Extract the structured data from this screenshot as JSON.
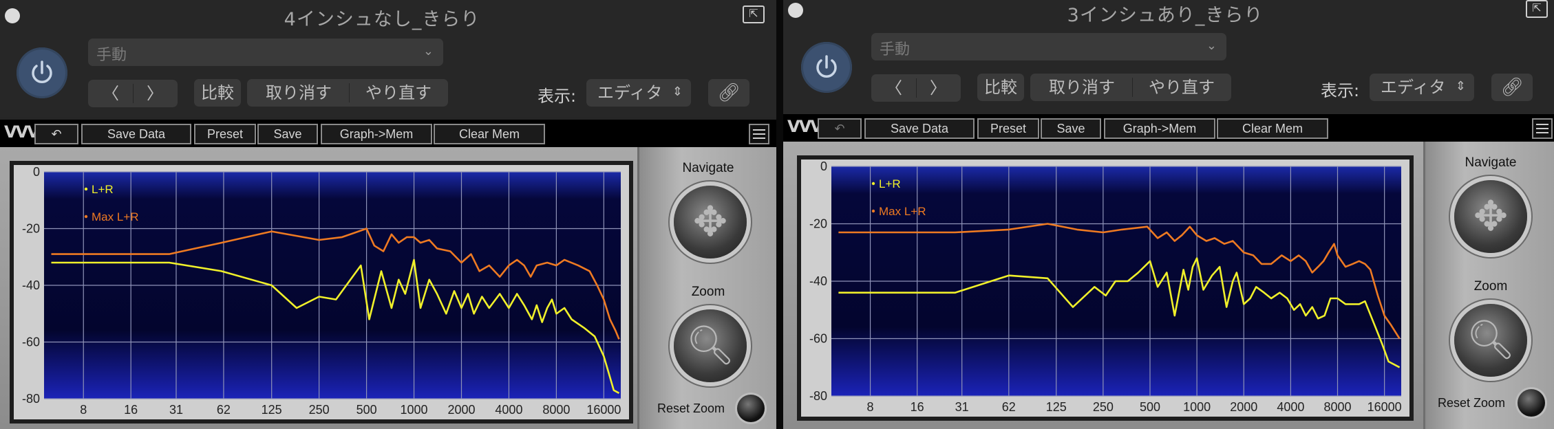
{
  "windows": [
    {
      "title": "4インシュなし_きらり",
      "preset_placeholder": "手動",
      "compare": "比較",
      "undo": "取り消す",
      "redo": "やり直す",
      "display_label": "表示:",
      "display_value": "エディタ",
      "toolbar": {
        "save_data": "Save Data",
        "preset": "Preset",
        "save": "Save",
        "graph_mem": "Graph->Mem",
        "clear_mem": "Clear Mem"
      },
      "navigate": "Navigate",
      "zoom": "Zoom",
      "reset_zoom": "Reset Zoom",
      "chart_data": {
        "type": "line",
        "x_ticks": [
          "8",
          "16",
          "31",
          "62",
          "125",
          "250",
          "500",
          "1000",
          "2000",
          "4000",
          "8000",
          "16000"
        ],
        "y_ticks": [
          "0",
          "-20",
          "-40",
          "-60",
          "-80"
        ],
        "ylim": [
          -80,
          0
        ],
        "series": [
          {
            "name": "L+R",
            "color": "#f0f02a",
            "points": [
              [
                5,
                -32
              ],
              [
                28,
                -32
              ],
              [
                60,
                -35
              ],
              [
                125,
                -40
              ],
              [
                180,
                -48
              ],
              [
                250,
                -44
              ],
              [
                320,
                -45
              ],
              [
                460,
                -33
              ],
              [
                520,
                -52
              ],
              [
                620,
                -35
              ],
              [
                720,
                -48
              ],
              [
                800,
                -38
              ],
              [
                880,
                -43
              ],
              [
                1000,
                -31
              ],
              [
                1100,
                -48
              ],
              [
                1250,
                -38
              ],
              [
                1400,
                -43
              ],
              [
                1600,
                -50
              ],
              [
                1800,
                -42
              ],
              [
                2000,
                -48
              ],
              [
                2200,
                -43
              ],
              [
                2400,
                -50
              ],
              [
                2700,
                -44
              ],
              [
                3000,
                -48
              ],
              [
                3500,
                -43
              ],
              [
                4000,
                -48
              ],
              [
                4500,
                -43
              ],
              [
                5000,
                -47
              ],
              [
                5600,
                -52
              ],
              [
                6000,
                -47
              ],
              [
                6500,
                -53
              ],
              [
                7000,
                -48
              ],
              [
                7500,
                -45
              ],
              [
                8000,
                -50
              ],
              [
                9000,
                -48
              ],
              [
                10000,
                -52
              ],
              [
                12000,
                -55
              ],
              [
                14000,
                -58
              ],
              [
                16000,
                -65
              ],
              [
                17000,
                -70
              ],
              [
                18500,
                -77
              ],
              [
                20000,
                -78
              ]
            ]
          },
          {
            "name": "Max L+R",
            "color": "#ee7a22",
            "points": [
              [
                5,
                -29
              ],
              [
                28,
                -29
              ],
              [
                60,
                -25
              ],
              [
                125,
                -21
              ],
              [
                250,
                -24
              ],
              [
                350,
                -23
              ],
              [
                500,
                -20
              ],
              [
                560,
                -26
              ],
              [
                640,
                -28
              ],
              [
                720,
                -22
              ],
              [
                800,
                -25
              ],
              [
                900,
                -23
              ],
              [
                1000,
                -23
              ],
              [
                1100,
                -25
              ],
              [
                1250,
                -24
              ],
              [
                1400,
                -27
              ],
              [
                1700,
                -28
              ],
              [
                2000,
                -32
              ],
              [
                2300,
                -29
              ],
              [
                2600,
                -35
              ],
              [
                3000,
                -33
              ],
              [
                3500,
                -37
              ],
              [
                4000,
                -33
              ],
              [
                4500,
                -31
              ],
              [
                5000,
                -33
              ],
              [
                5500,
                -37
              ],
              [
                6000,
                -33
              ],
              [
                7000,
                -32
              ],
              [
                8000,
                -33
              ],
              [
                9000,
                -31
              ],
              [
                11000,
                -33
              ],
              [
                13000,
                -35
              ],
              [
                14500,
                -40
              ],
              [
                16000,
                -45
              ],
              [
                17500,
                -52
              ],
              [
                19000,
                -56
              ],
              [
                20000,
                -59
              ]
            ]
          }
        ]
      }
    },
    {
      "title": "3インシュあり_きらり",
      "preset_placeholder": "手動",
      "compare": "比較",
      "undo": "取り消す",
      "redo": "やり直す",
      "display_label": "表示:",
      "display_value": "エディタ",
      "toolbar": {
        "save_data": "Save Data",
        "preset": "Preset",
        "save": "Save",
        "graph_mem": "Graph->Mem",
        "clear_mem": "Clear Mem"
      },
      "navigate": "Navigate",
      "zoom": "Zoom",
      "reset_zoom": "Reset Zoom",
      "chart_data": {
        "type": "line",
        "x_ticks": [
          "8",
          "16",
          "31",
          "62",
          "125",
          "250",
          "500",
          "1000",
          "2000",
          "4000",
          "8000",
          "16000"
        ],
        "y_ticks": [
          "0",
          "-20",
          "-40",
          "-60",
          "-80"
        ],
        "ylim": [
          -80,
          0
        ],
        "series": [
          {
            "name": "L+R",
            "color": "#f0f02a",
            "points": [
              [
                5,
                -44
              ],
              [
                28,
                -44
              ],
              [
                62,
                -38
              ],
              [
                110,
                -39
              ],
              [
                160,
                -49
              ],
              [
                220,
                -42
              ],
              [
                260,
                -45
              ],
              [
                300,
                -40
              ],
              [
                360,
                -40
              ],
              [
                420,
                -37
              ],
              [
                500,
                -33
              ],
              [
                560,
                -42
              ],
              [
                640,
                -37
              ],
              [
                720,
                -52
              ],
              [
                820,
                -36
              ],
              [
                880,
                -43
              ],
              [
                940,
                -35
              ],
              [
                1000,
                -32
              ],
              [
                1100,
                -43
              ],
              [
                1250,
                -38
              ],
              [
                1400,
                -35
              ],
              [
                1550,
                -49
              ],
              [
                1700,
                -40
              ],
              [
                1800,
                -37
              ],
              [
                2000,
                -48
              ],
              [
                2200,
                -46
              ],
              [
                2400,
                -42
              ],
              [
                2700,
                -44
              ],
              [
                3000,
                -46
              ],
              [
                3400,
                -44
              ],
              [
                3800,
                -46
              ],
              [
                4200,
                -50
              ],
              [
                4600,
                -48
              ],
              [
                5000,
                -52
              ],
              [
                5500,
                -49
              ],
              [
                6000,
                -53
              ],
              [
                6600,
                -52
              ],
              [
                7200,
                -46
              ],
              [
                8000,
                -46
              ],
              [
                9000,
                -48
              ],
              [
                10000,
                -48
              ],
              [
                11000,
                -48
              ],
              [
                12000,
                -47
              ],
              [
                14000,
                -56
              ],
              [
                15500,
                -62
              ],
              [
                17000,
                -68
              ],
              [
                20000,
                -70
              ]
            ]
          },
          {
            "name": "Max L+R",
            "color": "#ee7a22",
            "points": [
              [
                5,
                -23
              ],
              [
                28,
                -23
              ],
              [
                62,
                -22
              ],
              [
                110,
                -20
              ],
              [
                170,
                -22
              ],
              [
                250,
                -23
              ],
              [
                330,
                -22
              ],
              [
                480,
                -21
              ],
              [
                560,
                -25
              ],
              [
                640,
                -23
              ],
              [
                720,
                -26
              ],
              [
                800,
                -24
              ],
              [
                900,
                -21
              ],
              [
                1000,
                -24
              ],
              [
                1150,
                -26
              ],
              [
                1300,
                -25
              ],
              [
                1500,
                -27
              ],
              [
                1700,
                -26
              ],
              [
                2000,
                -30
              ],
              [
                2300,
                -31
              ],
              [
                2600,
                -34
              ],
              [
                3000,
                -34
              ],
              [
                3500,
                -31
              ],
              [
                4000,
                -33
              ],
              [
                4500,
                -31
              ],
              [
                5000,
                -33
              ],
              [
                5500,
                -37
              ],
              [
                6000,
                -35
              ],
              [
                6500,
                -33
              ],
              [
                7000,
                -30
              ],
              [
                7600,
                -27
              ],
              [
                8000,
                -31
              ],
              [
                9000,
                -35
              ],
              [
                10000,
                -34
              ],
              [
                11000,
                -33
              ],
              [
                12000,
                -34
              ],
              [
                13000,
                -36
              ],
              [
                14500,
                -45
              ],
              [
                16000,
                -52
              ],
              [
                17500,
                -55
              ],
              [
                20000,
                -60
              ]
            ]
          }
        ]
      }
    }
  ]
}
